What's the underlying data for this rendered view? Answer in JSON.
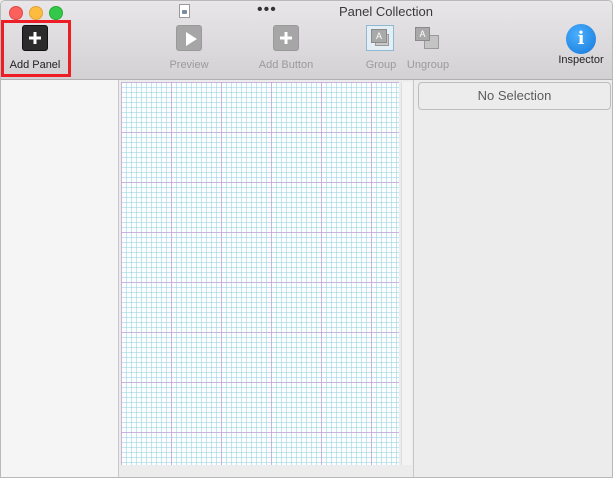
{
  "window": {
    "title": "Panel Collection",
    "more_glyph": "•••"
  },
  "toolbar": {
    "add_panel": "Add Panel",
    "preview": "Preview",
    "add_button": "Add Button",
    "group": "Group",
    "ungroup": "Ungroup",
    "inspector": "Inspector",
    "group_glyph": "A",
    "ungroup_glyph": "A",
    "info_glyph": "i"
  },
  "inspector": {
    "no_selection": "No Selection"
  },
  "colors": {
    "highlight": "#ee1c24",
    "info_accent": "#1677d8"
  },
  "icons": [
    "doc-icon",
    "plus-icon",
    "play-icon",
    "plus-icon",
    "group-icon",
    "ungroup-icon",
    "info-icon"
  ]
}
